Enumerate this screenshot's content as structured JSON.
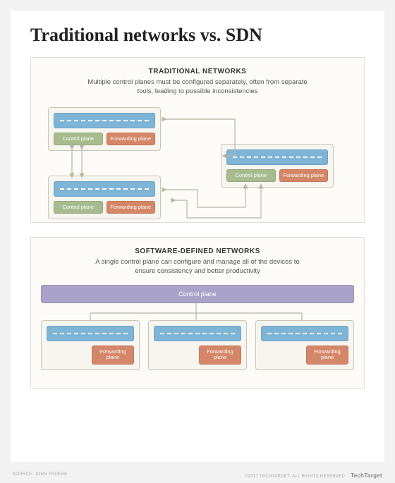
{
  "title": "Traditional networks vs. SDN",
  "traditional": {
    "heading": "TRADITIONAL NETWORKS",
    "description": "Multiple control planes must be configured separately, often from separate tools, leading to possible inconsistencies",
    "control_label": "Control plane",
    "forwarding_label": "Forwarding plane"
  },
  "sdn": {
    "heading": "SOFTWARE-DEFINED NETWORKS",
    "description": "A single control plane can configure and manage all of the devices to ensure consistency and better productivity",
    "control_label": "Control plane",
    "forwarding_label": "Forwarding plane"
  },
  "footer": {
    "source": "SOURCE: JOHN FRUEHE",
    "rights": "©2017 TECHTARGET. ALL RIGHTS RESERVED",
    "brand": "TechTarget"
  }
}
